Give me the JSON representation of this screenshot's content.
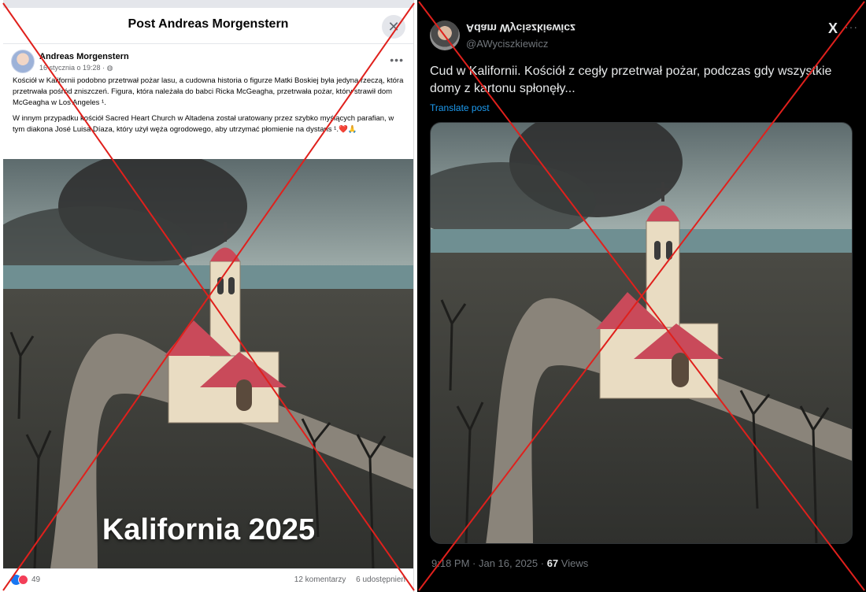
{
  "facebook_post": {
    "header_title": "Post Andreas Morgenstern",
    "close_icon": "close-icon",
    "author": "Andreas Morgenstern",
    "timestamp": "16 stycznia o 19:28 · ",
    "paragraph_1": "Kościół w Kalifornii podobno przetrwał pożar lasu, a cudowna historia o figurze Matki Boskiej była jedyną rzeczą, która przetrwała pośród zniszczeń. Figura, która należała do babci Ricka McGeagha, przetrwała pożar, który strawił dom McGeagha w Los Angeles ¹.",
    "paragraph_2": "W innym przypadku kościół Sacred Heart Church w Altadena został uratowany przez szybko myślących parafian, w tym diakona José Luisa Díaza, który użył węża ogrodowego, aby utrzymać płomienie na dystans ¹.❤️🙏",
    "image_caption": "Kalifornia 2025",
    "reaction_count": "49",
    "comments": "12 komentarzy",
    "shares": "6 udostępnień"
  },
  "x_post": {
    "display_name": "Adam Wyciszkiewicz",
    "handle": "@AWyciszkiewicz",
    "text": "Cud w Kalifornii. Kościół z cegły przetrwał pożar, podczas gdy wszystkie domy z kartonu spłonęły...",
    "translate_link": "Translate post",
    "timestamp": "9:18 PM · Jan 16, 2025 · ",
    "views_count": "67",
    "views_label": " Views"
  },
  "colors": {
    "x_mark": "#e0201c",
    "fb_blue": "#1877f2",
    "x_link": "#1d9bf0",
    "roof_red": "#c94a5a"
  }
}
